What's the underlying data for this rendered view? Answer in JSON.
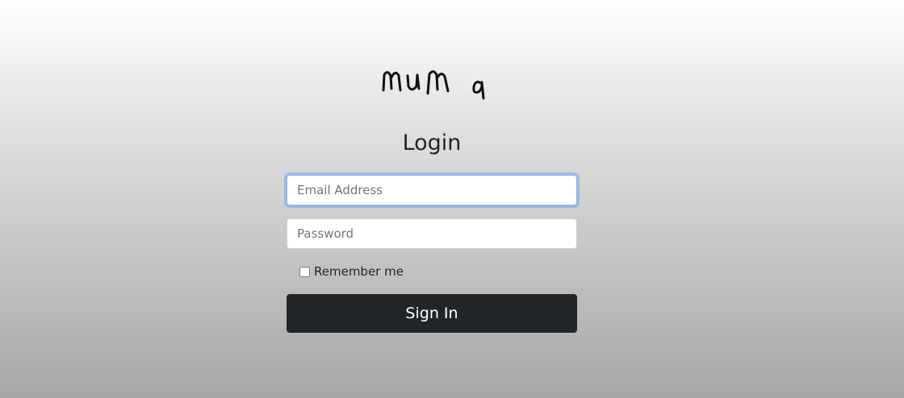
{
  "logo": {
    "text": "muma"
  },
  "form": {
    "title": "Login",
    "email_placeholder": "Email Address",
    "password_placeholder": "Password",
    "remember_label": "Remember me",
    "remember_checked": false,
    "submit_label": "Sign In"
  },
  "colors": {
    "button_bg": "#212529",
    "focus_ring": "#86b7fe"
  }
}
